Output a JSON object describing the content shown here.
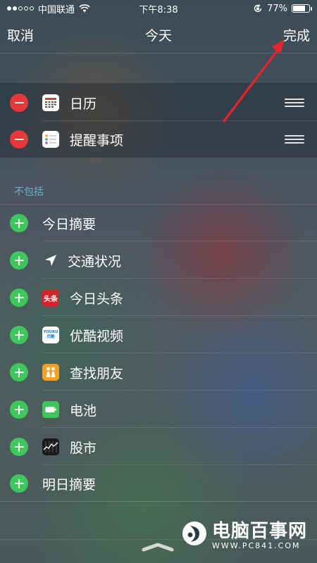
{
  "status_bar": {
    "carrier": "中国联通",
    "time": "下午8:38",
    "battery_percent": "77%",
    "battery_level": 0.77,
    "signal_filled": 2,
    "signal_total": 5
  },
  "nav": {
    "cancel_label": "取消",
    "title": "今天",
    "done_label": "完成"
  },
  "included": [
    {
      "label": "日历",
      "icon": "calendar-icon"
    },
    {
      "label": "提醒事项",
      "icon": "reminders-icon"
    }
  ],
  "section_header": "不包括",
  "excluded": [
    {
      "label": "今日摘要",
      "icon": null
    },
    {
      "label": "交通状况",
      "icon": "location-arrow-icon"
    },
    {
      "label": "今日头条",
      "icon": "toutiao-icon",
      "icon_text": "头条"
    },
    {
      "label": "优酷视频",
      "icon": "youku-icon",
      "icon_text": "YOUKU 优酷"
    },
    {
      "label": "查找朋友",
      "icon": "find-friends-icon"
    },
    {
      "label": "电池",
      "icon": "battery-icon"
    },
    {
      "label": "股市",
      "icon": "stocks-icon"
    },
    {
      "label": "明日摘要",
      "icon": null
    }
  ],
  "watermark": {
    "title": "电脑百事网",
    "url": "WWW.PC841.COM"
  },
  "colors": {
    "remove": "#e8393a",
    "add": "#3ec85c",
    "section_header": "#6bb0c8",
    "annotation_arrow": "#e8242a"
  }
}
